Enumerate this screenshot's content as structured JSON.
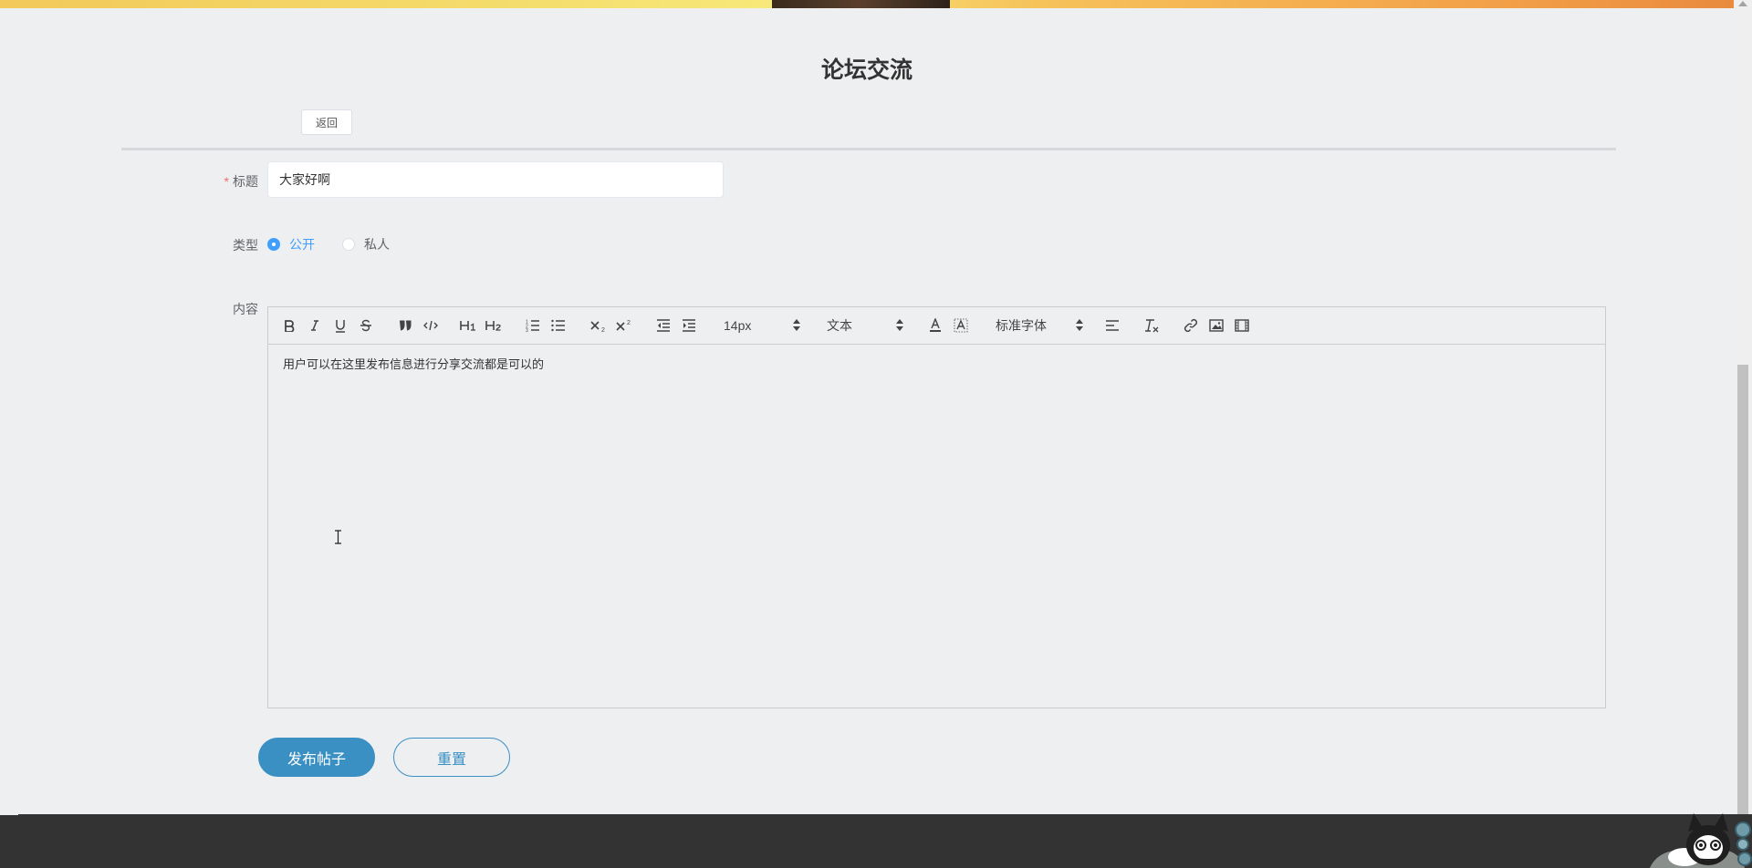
{
  "page": {
    "title": "论坛交流",
    "back_label": "返回"
  },
  "form": {
    "title_label": "标题",
    "title_required_mark": "*",
    "title_value": "大家好啊",
    "type_label": "类型",
    "type_options": [
      {
        "label": "公开",
        "checked": true
      },
      {
        "label": "私人",
        "checked": false
      }
    ],
    "content_label": "内容",
    "content_text": "用户可以在这里发布信息进行分享交流都是可以的",
    "submit_label": "发布帖子",
    "reset_label": "重置"
  },
  "editor_toolbar": {
    "font_size": "14px",
    "header": "文本",
    "font_family": "标准字体",
    "icons": [
      "bold-icon",
      "italic-icon",
      "underline-icon",
      "strikethrough-icon",
      "blockquote-icon",
      "code-block-icon",
      "heading-1-icon",
      "heading-2-icon",
      "ordered-list-icon",
      "bullet-list-icon",
      "subscript-icon",
      "superscript-icon",
      "outdent-icon",
      "indent-icon",
      "text-color-icon",
      "background-color-icon",
      "align-icon",
      "clear-format-icon",
      "link-icon",
      "image-icon",
      "video-icon"
    ]
  },
  "colors": {
    "accent": "#3a8fc3",
    "radio_checked": "#409eff",
    "background": "#eeeff1",
    "footer": "#333333",
    "required": "#f56c6c"
  }
}
